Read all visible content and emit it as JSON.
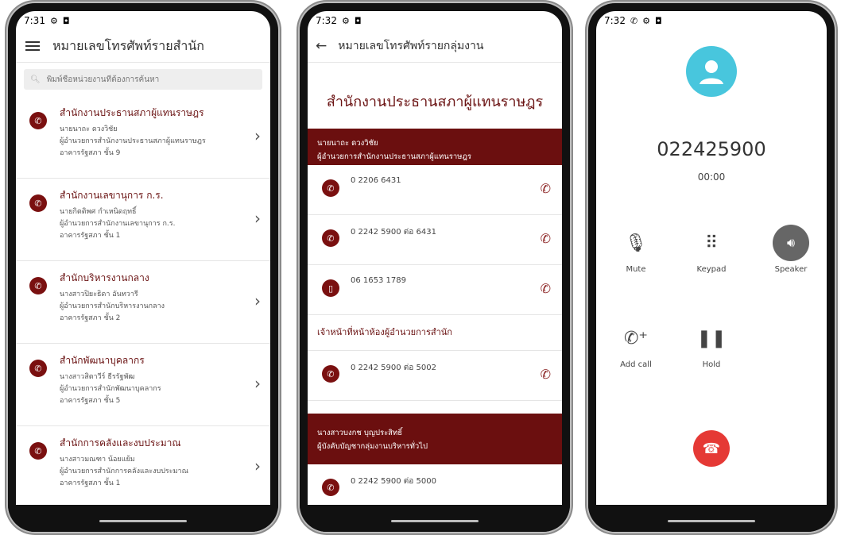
{
  "phone1": {
    "time": "7:31",
    "title": "หมายเลขโทรศัพท์รายสำนัก",
    "search_placeholder": "พิมพ์ชื่อหน่วยงานที่ต้องการค้นหา",
    "items": [
      {
        "name": "สำนักงานประธานสภาผู้แทนราษฎร",
        "person": "นายนาถะ ดวงวิชัย",
        "role": "ผู้อำนวยการสำนักงานประธานสภาผู้แทนราษฎร",
        "building": "อาคารรัฐสภา ชั้น 9"
      },
      {
        "name": "สำนักงานเลขานุการ ก.ร.",
        "person": "นายกิตติพศ กำเหนิดฤทธิ์",
        "role": "ผู้อำนวยการสำนักงานเลขานุการ ก.ร.",
        "building": "อาคารรัฐสภา ชั้น 1"
      },
      {
        "name": "สำนักบริหารงานกลาง",
        "person": "นางสาวปิยะธิดา อันทวารี",
        "role": "ผู้อำนวยการสำนักบริหารงานกลาง",
        "building": "อาคารรัฐสภา ชั้น 2"
      },
      {
        "name": "สำนักพัฒนาบุคลากร",
        "person": "นางสาวสิตาวีร์ ธีรรัฐพัฒ",
        "role": "ผู้อำนวยการสำนักพัฒนาบุคลากร",
        "building": "อาคารรัฐสภา ชั้น 5"
      },
      {
        "name": "สำนักการคลังและงบประมาณ",
        "person": "นางสาวมณฑา น้อยแย้ม",
        "role": "ผู้อำนวยการสำนักการคลังและงบประมาณ",
        "building": "อาคารรัฐสภา ชั้น 1"
      }
    ]
  },
  "phone2": {
    "time": "7:32",
    "title": "หมายเลขโทรศัพท์รายกลุ่มงาน",
    "heading": "สำนักงานประธานสภาผู้แทนราษฎร",
    "banner1": {
      "line1": "นายนาถะ ดวงวิชัย",
      "line2": "ผู้อำนวยการสำนักงานประธานสภาผู้แทนราษฎร"
    },
    "numbers": [
      "0 2206 6431",
      "0 2242 5900  ต่อ  6431",
      "06 1653 1789"
    ],
    "section": "เจ้าหน้าที่หน้าห้องผู้อำนวยการสำนัก",
    "section_number": "0 2242 5900  ต่อ  5002",
    "banner2": {
      "line1": "นางสาวบงกช บุญประสิทธิ์",
      "line2": "ผู้บังคับบัญชากลุ่มงานบริหารทั่วไป"
    },
    "last_number": "0 2242 5900  ต่อ  5000"
  },
  "phone3": {
    "time": "7:32",
    "number": "022425900",
    "duration": "00:00",
    "mute": "Mute",
    "keypad": "Keypad",
    "speaker": "Speaker",
    "add_call": "Add call",
    "hold": "Hold"
  },
  "colors": {
    "accent": "#6b0f0f",
    "avatar": "#48c6dd",
    "end_call": "#e53935"
  }
}
